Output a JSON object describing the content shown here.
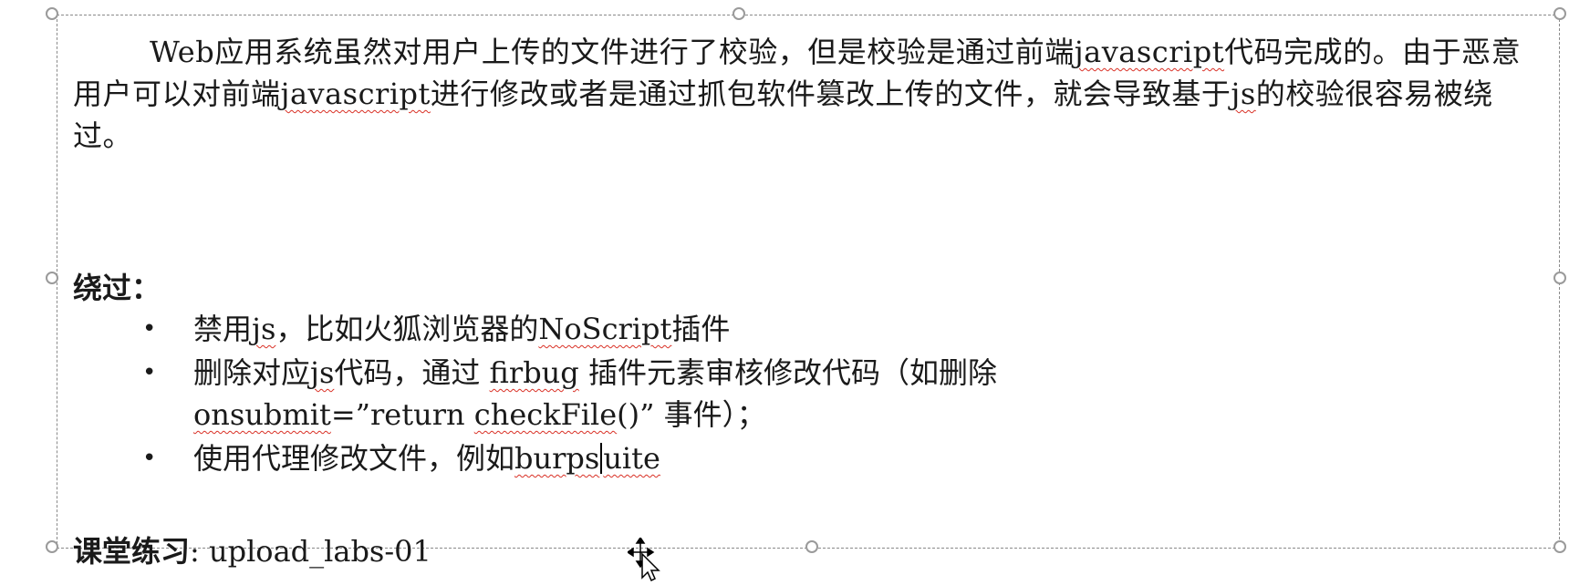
{
  "paragraph": {
    "seg1": "Web应用系统虽然对用户上传的文件进行了校验，但是校验是通过前端",
    "word1": "javascript",
    "seg2": "代码完成的。由于恶意用户可以对前端",
    "word2": "javascript",
    "seg3": "进行修改或者是通过抓包软件篡改上传的文件，就会导致基于",
    "word3": "js",
    "seg4": "的校验很容易被绕过。"
  },
  "bypass": {
    "heading": "绕过：",
    "bullet_symbol": "•",
    "items": [
      {
        "a": "禁用",
        "b": "js",
        "c": "，比如火狐浏览器的",
        "d": "NoScript",
        "e": "插件"
      },
      {
        "a": "删除对应",
        "b": "js",
        "c": "代码，通过 ",
        "d": "firbug",
        "e": " 插件元素审核修改代码（如删除",
        "f": "onsubmit",
        "g": "=”return ",
        "h": "checkFile",
        "i": "()” 事件）；"
      },
      {
        "a": "使用代理修改文件，例如",
        "b": "burps",
        "c": "uite"
      }
    ]
  },
  "exercise": {
    "label": "课堂练习",
    "value": ": upload_labs-01"
  }
}
